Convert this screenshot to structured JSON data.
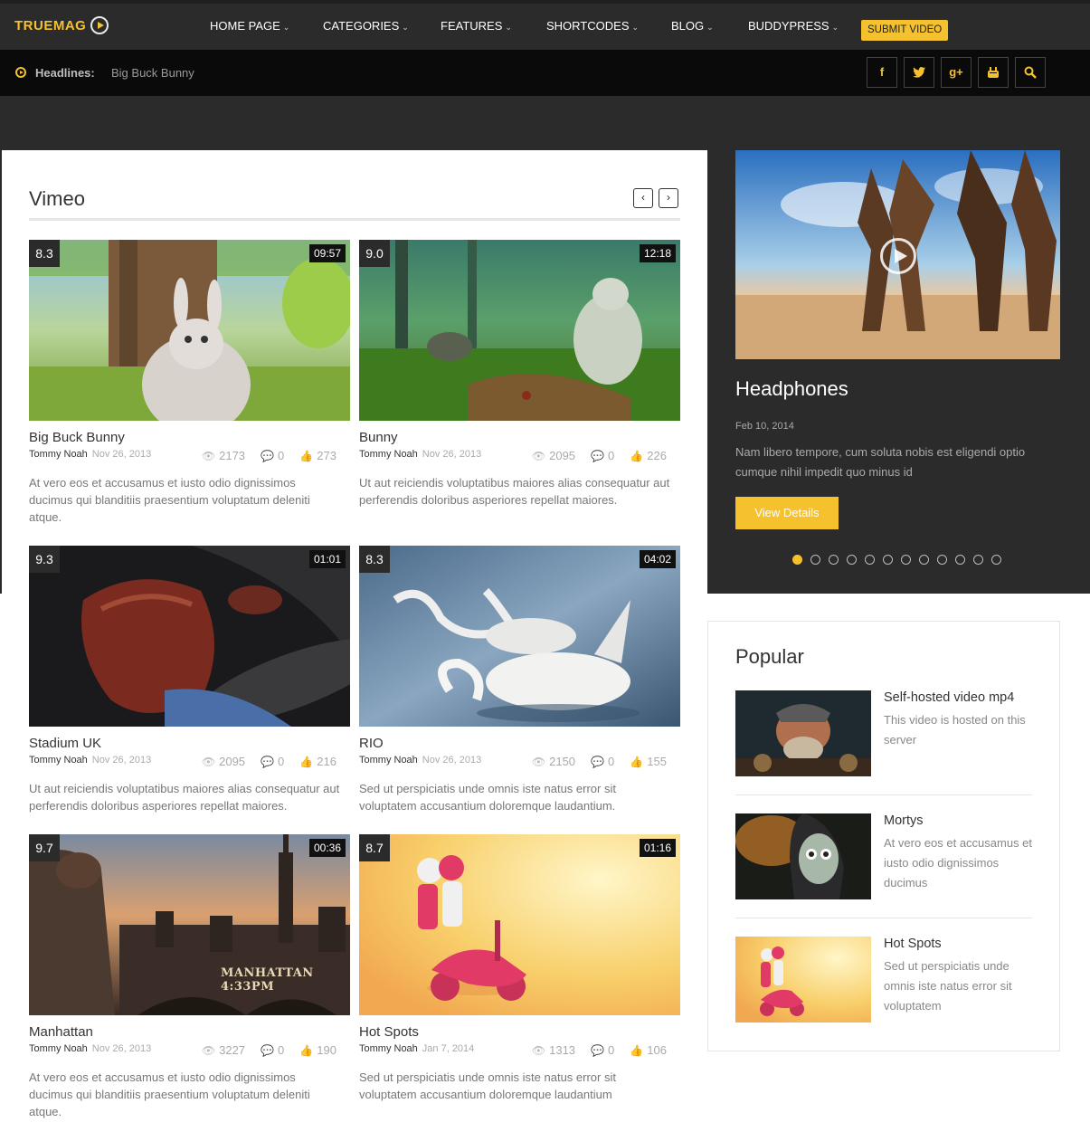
{
  "brand": {
    "name": "TRUEMAG",
    "accent": "#f5c12e",
    "dark": "#2b2b2b"
  },
  "nav": {
    "items": [
      {
        "label": "HOME PAGE"
      },
      {
        "label": "CATEGORIES"
      },
      {
        "label": "FEATURES"
      },
      {
        "label": "SHORTCODES"
      },
      {
        "label": "BLOG"
      },
      {
        "label": "BUDDYPRESS"
      }
    ],
    "caret": "⌄",
    "submit_label": "SUBMIT VIDEO"
  },
  "headlines": {
    "label": "Headlines:",
    "value": "Big Buck Bunny"
  },
  "social": [
    {
      "icon": "facebook-icon",
      "glyph": "f"
    },
    {
      "icon": "twitter-icon",
      "glyph": "🐦"
    },
    {
      "icon": "google-plus-icon",
      "glyph": "g+"
    },
    {
      "icon": "youtube-icon",
      "glyph": "▶"
    },
    {
      "icon": "search-icon",
      "glyph": "⌕"
    }
  ],
  "main": {
    "section_title": "Vimeo",
    "prev_label": "‹",
    "next_label": "›",
    "videos": [
      {
        "rating": "8.3",
        "duration": "09:57",
        "title": "Big Buck Bunny",
        "author": "Tommy Noah",
        "date": "Nov 26, 2013",
        "views": "2173",
        "comments": "0",
        "likes": "273",
        "excerpt": "At vero eos et accusamus et iusto odio dignissimos ducimus qui blanditiis praesentium voluptatum deleniti atque."
      },
      {
        "rating": "9.0",
        "duration": "12:18",
        "title": "Bunny",
        "author": "Tommy Noah",
        "date": "Nov 26, 2013",
        "views": "2095",
        "comments": "0",
        "likes": "226",
        "excerpt": "Ut aut reiciendis voluptatibus maiores alias consequatur aut perferendis doloribus asperiores repellat maiores."
      },
      {
        "rating": "9.3",
        "duration": "01:01",
        "title": "Stadium UK",
        "author": "Tommy Noah",
        "date": "Nov 26, 2013",
        "views": "2095",
        "comments": "0",
        "likes": "216",
        "excerpt": "Ut aut reiciendis voluptatibus maiores alias consequatur aut perferendis doloribus asperiores repellat maiores."
      },
      {
        "rating": "8.3",
        "duration": "04:02",
        "title": "RIO",
        "author": "Tommy Noah",
        "date": "Nov 26, 2013",
        "views": "2150",
        "comments": "0",
        "likes": "155",
        "excerpt": "Sed ut perspiciatis unde omnis iste natus error sit voluptatem accusantium doloremque laudantium."
      },
      {
        "rating": "9.7",
        "duration": "00:36",
        "title": "Manhattan",
        "author": "Tommy Noah",
        "date": "Nov 26, 2013",
        "views": "3227",
        "comments": "0",
        "likes": "190",
        "excerpt": "At vero eos et accusamus et iusto odio dignissimos ducimus qui blanditiis praesentium voluptatum deleniti atque."
      },
      {
        "rating": "8.7",
        "duration": "01:16",
        "title": "Hot Spots",
        "author": "Tommy Noah",
        "date": "Jan 7, 2014",
        "views": "1313",
        "comments": "0",
        "likes": "106",
        "excerpt": "Sed ut perspiciatis unde omnis iste natus error sit voluptatem accusantium doloremque laudantium"
      }
    ],
    "thumb_caption_manhattan": "MANHATTAN 4:33PM"
  },
  "featured": {
    "title": "Headphones",
    "date": "Feb 10, 2014",
    "description": "Nam libero tempore, cum soluta nobis est eligendi optio cumque nihil impedit quo minus id",
    "button_label": "View Details",
    "slide_count": 12,
    "active_slide": 1
  },
  "popular": {
    "title": "Popular",
    "items": [
      {
        "title": "Self-hosted video mp4",
        "excerpt": "This video is hosted on this server"
      },
      {
        "title": "Mortys",
        "excerpt": "At vero eos et accusamus et iusto odio dignissimos ducimus"
      },
      {
        "title": "Hot Spots",
        "excerpt": "Sed ut perspiciatis unde omnis iste natus error sit voluptatem"
      }
    ]
  }
}
